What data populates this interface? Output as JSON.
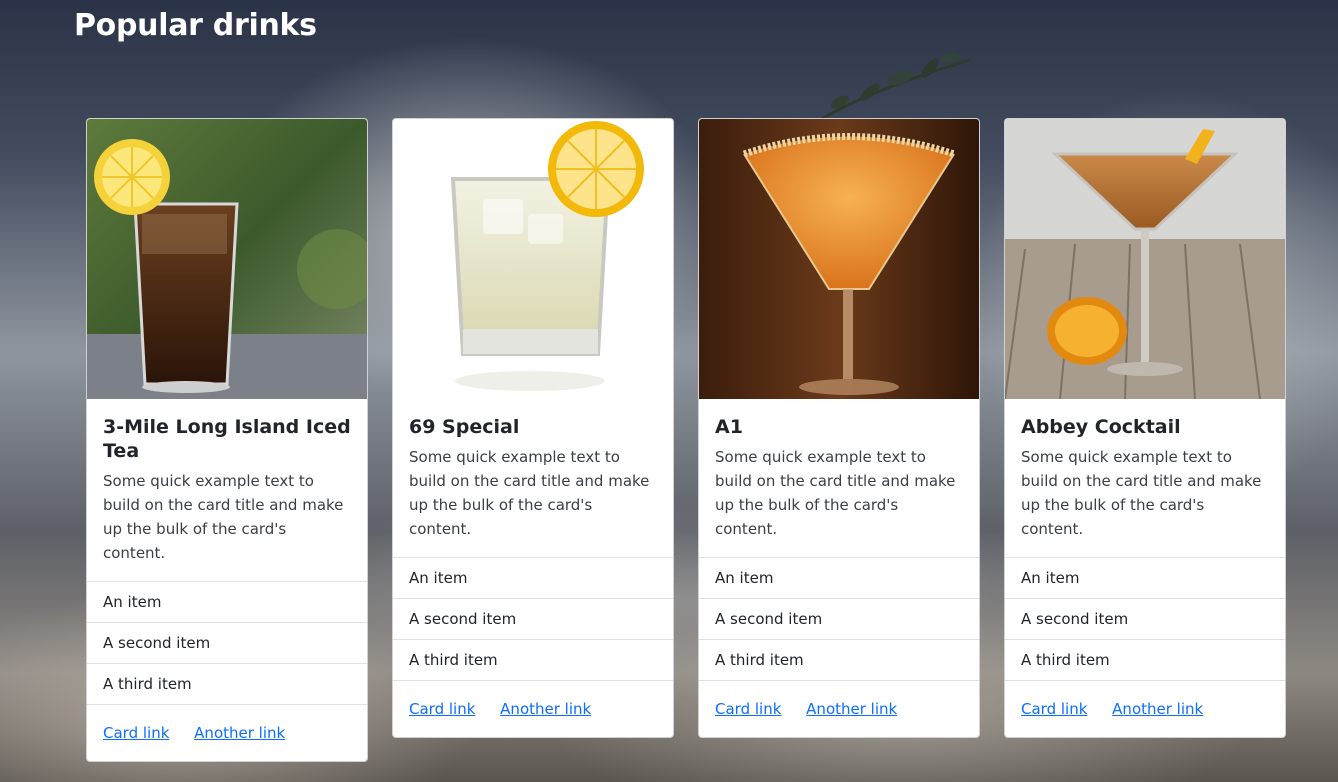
{
  "page": {
    "title": "Popular drinks"
  },
  "cards": [
    {
      "title": "3-Mile Long Island Iced Tea",
      "text": "Some quick example text to build on the card title and make up the bulk of the card's content.",
      "items": [
        "An item",
        "A second item",
        "A third item"
      ],
      "links": [
        "Card link",
        "Another link"
      ]
    },
    {
      "title": "69 Special",
      "text": "Some quick example text to build on the card title and make up the bulk of the card's content.",
      "items": [
        "An item",
        "A second item",
        "A third item"
      ],
      "links": [
        "Card link",
        "Another link"
      ]
    },
    {
      "title": "A1",
      "text": "Some quick example text to build on the card title and make up the bulk of the card's content.",
      "items": [
        "An item",
        "A second item",
        "A third item"
      ],
      "links": [
        "Card link",
        "Another link"
      ]
    },
    {
      "title": "Abbey Cocktail",
      "text": "Some quick example text to build on the card title and make up the bulk of the card's content.",
      "items": [
        "An item",
        "A second item",
        "A third item"
      ],
      "links": [
        "Card link",
        "Another link"
      ]
    }
  ],
  "colors": {
    "link": "#0d6efd",
    "heading": "#ffffff",
    "card_bg": "#ffffff"
  }
}
